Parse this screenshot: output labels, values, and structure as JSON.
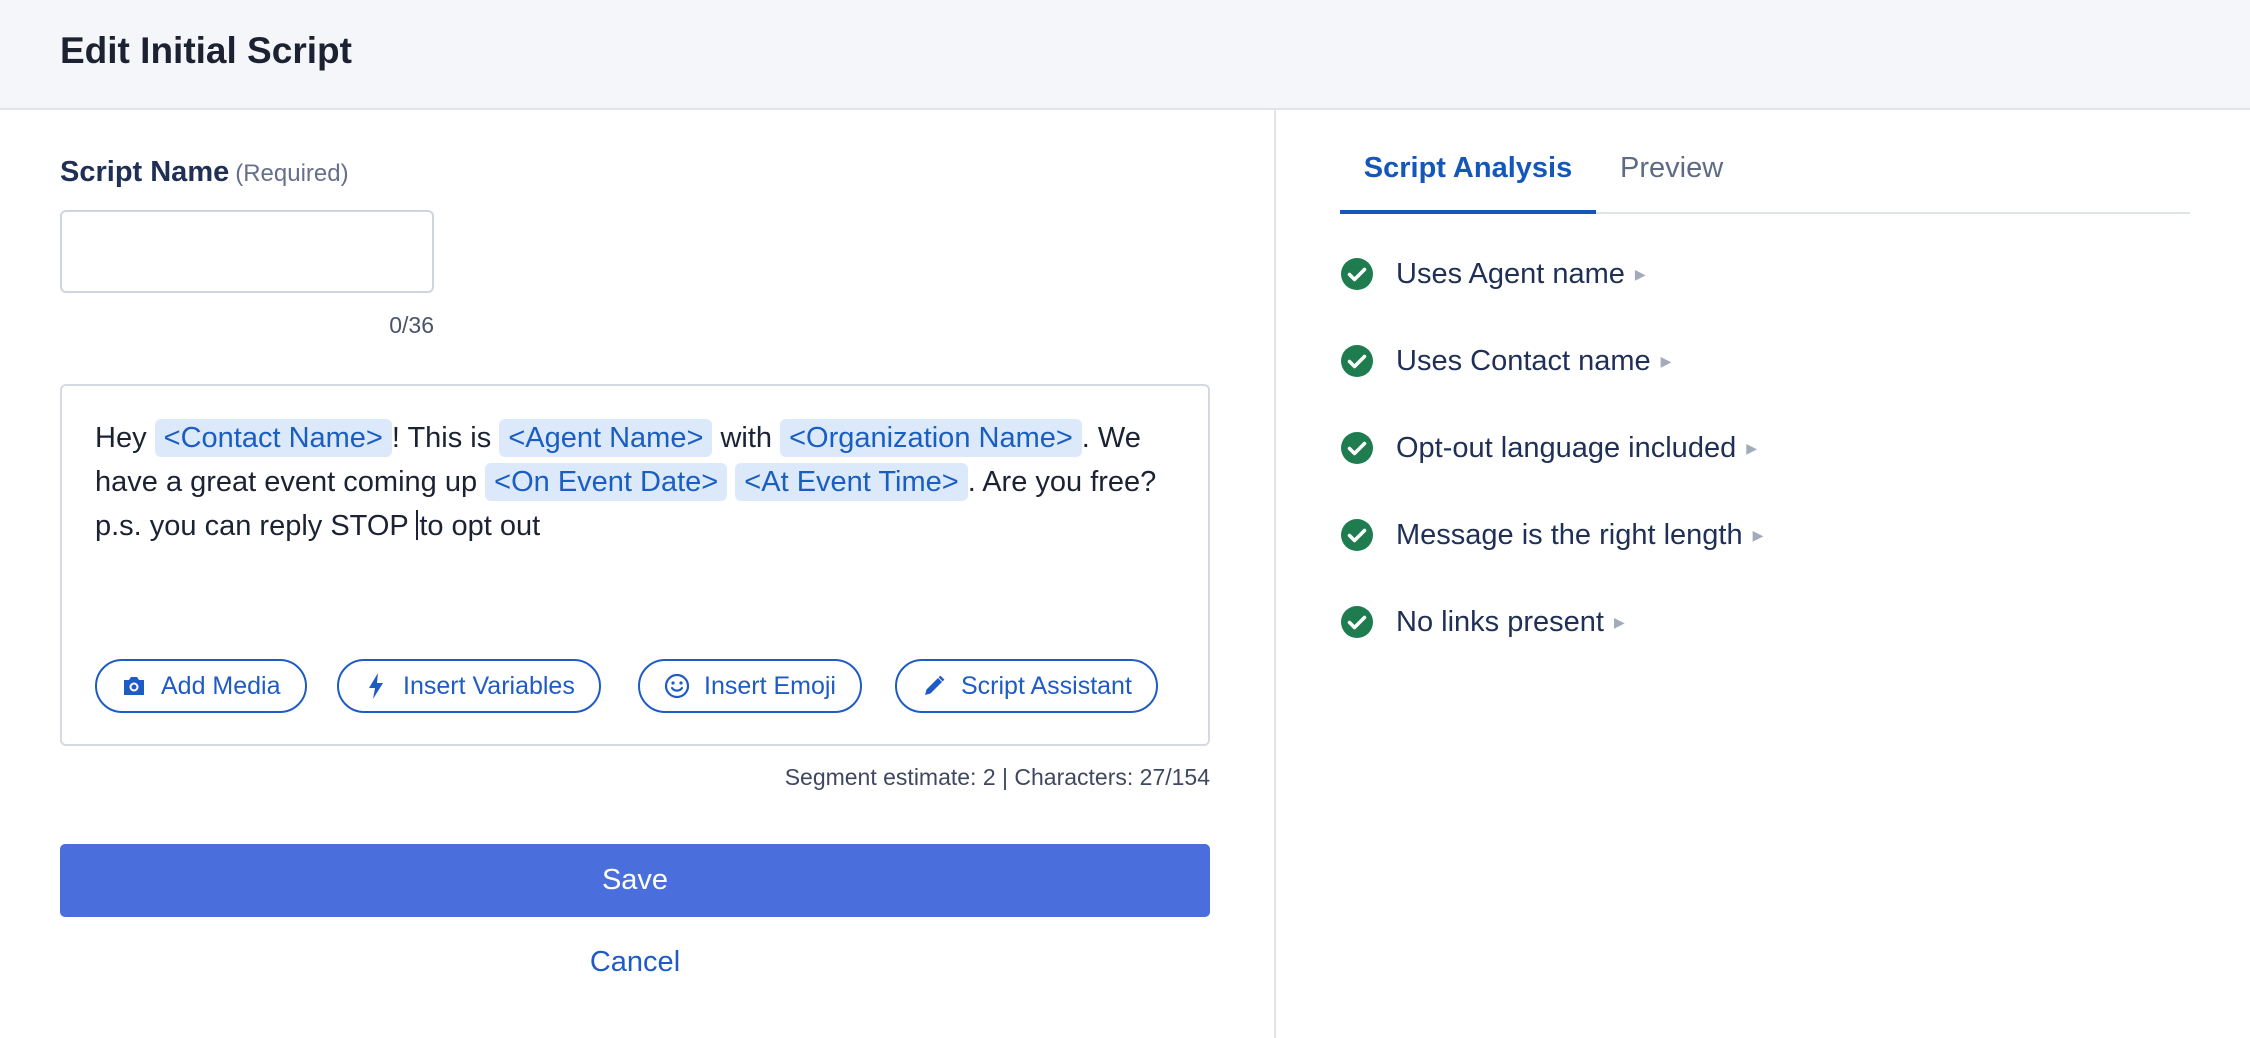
{
  "header": {
    "title": "Edit Initial Script"
  },
  "form": {
    "script_name_label": "Script Name",
    "script_name_required": "(Required)",
    "script_name_value": "",
    "script_name_counter": "0/36",
    "message": {
      "t1": "Hey ",
      "v_contact": "<Contact Name>",
      "t2": "! This is ",
      "v_agent": "<Agent Name>",
      "t3": " with ",
      "v_org": "<Organization Name>",
      "t4": ". We have a great event coming up ",
      "v_date": "<On Event Date>",
      "t5": " ",
      "v_time": "<At Event Time>",
      "t6": ". Are you free? p.s. you can reply STOP ",
      "t7": "to opt out"
    },
    "buttons": {
      "add_media": "Add Media",
      "insert_variables": "Insert Variables",
      "insert_emoji": "Insert Emoji",
      "script_assistant": "Script Assistant"
    },
    "segment_info": "Segment estimate: 2 | Characters: 27/154",
    "save_label": "Save",
    "cancel_label": "Cancel"
  },
  "analysis": {
    "tabs": [
      "Script Analysis",
      "Preview"
    ],
    "active_tab": "Script Analysis",
    "checks": [
      {
        "label": "Uses Agent name",
        "status": "pass",
        "icon": "check-circle-icon"
      },
      {
        "label": "Uses Contact name",
        "status": "pass",
        "icon": "check-circle-icon"
      },
      {
        "label": "Opt-out language included",
        "status": "pass",
        "icon": "check-circle-icon"
      },
      {
        "label": "Message is the right length",
        "status": "pass",
        "icon": "check-circle-icon"
      },
      {
        "label": "No links present",
        "status": "pass",
        "icon": "check-circle-icon"
      }
    ]
  },
  "colors": {
    "primary_button": "#4a6fdc",
    "link_blue": "#1f5bc4",
    "chip_bg": "#dbe9fb",
    "check_green": "#1e7c4f"
  }
}
